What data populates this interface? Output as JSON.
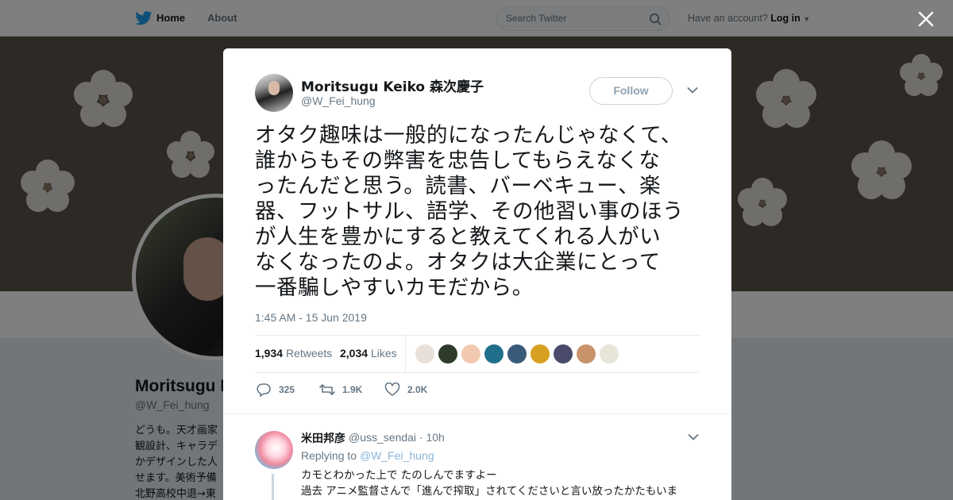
{
  "topbar": {
    "home_label": "Home",
    "about_label": "About",
    "search_placeholder": "Search Twitter",
    "have_account": "Have an account?",
    "login_label": "Log in"
  },
  "profile": {
    "name": "Moritsugu K",
    "handle": "@W_Fei_hung",
    "bio": "どうも。天才画家\n観設計、キャラデ\nかデザインした人\nせます。美術予備\n北野高校中退→東"
  },
  "tweet": {
    "author_name": "Moritsugu Keiko 森次慶子",
    "author_handle": "@W_Fei_hung",
    "follow_label": "Follow",
    "text": "オタク趣味は一般的になったんじゃなくて、\n誰からもその弊害を忠告してもらえなくな\nったんだと思う。読書、バーベキュー、楽\n器、フットサル、語学、その他習い事のほう\nが人生を豊かにすると教えてくれる人がい\nなくなったのよ。オタクは大企業にとって\n一番騙しやすいカモだから。",
    "timestamp": "1:45 AM - 15 Jun 2019",
    "retweet_count": "1,934",
    "retweet_label": "Retweets",
    "like_count": "2,034",
    "like_label": "Likes",
    "reply_action_count": "325",
    "retweet_action_count": "1.9K",
    "like_action_count": "2.0K"
  },
  "likers": [
    {
      "color": "#e8e0d8"
    },
    {
      "color": "#2e3b2a"
    },
    {
      "color": "#f2c9b0"
    },
    {
      "color": "#1f6f8b"
    },
    {
      "color": "#3a5a7a"
    },
    {
      "color": "#d8a020"
    },
    {
      "color": "#4a4a6a"
    },
    {
      "color": "#c8926a"
    },
    {
      "color": "#e8e4d8"
    }
  ],
  "reply": {
    "name": "米田邦彦",
    "handle": "@uss_sendai",
    "time": "· 10h",
    "replying_to_label": "Replying to",
    "replying_to_handle": "@W_Fei_hung",
    "text": "カモとわかった上で たのしんでますよー\n過去 アニメ監督さんで「進んで搾取」されてくださいと言い放ったかたもいま"
  },
  "colors": {
    "accent": "#1da1f2",
    "overlay": "rgba(0,0,0,0.5)"
  }
}
